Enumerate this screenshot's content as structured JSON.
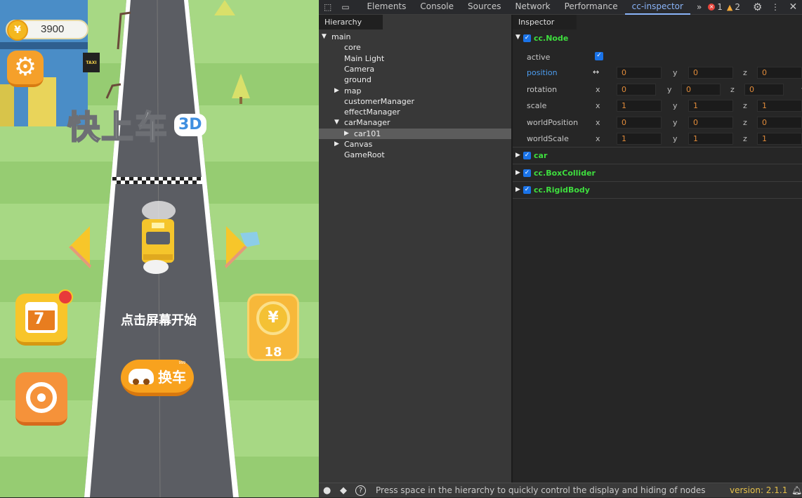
{
  "game": {
    "coins": "3900",
    "title": "快上车",
    "title_badge": "3D",
    "taxi_sign": "TAXI",
    "start_hint": "点击屏幕开始",
    "calendar_day": "7",
    "reward_count": "18",
    "change_car_label": "换车",
    "change_car_tag": "999"
  },
  "devtools": {
    "tabs": [
      "Elements",
      "Console",
      "Sources",
      "Network",
      "Performance",
      "cc-inspector"
    ],
    "active_tab": "cc-inspector",
    "error_count": "1",
    "warning_count": "2",
    "hierarchy": {
      "title": "Hierarchy",
      "nodes": [
        {
          "label": "main",
          "depth": 0,
          "expander": "open"
        },
        {
          "label": "core",
          "depth": 1,
          "expander": "none"
        },
        {
          "label": "Main Light",
          "depth": 1,
          "expander": "none"
        },
        {
          "label": "Camera",
          "depth": 1,
          "expander": "none"
        },
        {
          "label": "ground",
          "depth": 1,
          "expander": "none"
        },
        {
          "label": "map",
          "depth": 1,
          "expander": "closed"
        },
        {
          "label": "customerManager",
          "depth": 1,
          "expander": "none"
        },
        {
          "label": "effectManager",
          "depth": 1,
          "expander": "none"
        },
        {
          "label": "carManager",
          "depth": 1,
          "expander": "open"
        },
        {
          "label": "car101",
          "depth": 2,
          "expander": "closed",
          "selected": true
        },
        {
          "label": "Canvas",
          "depth": 1,
          "expander": "closed"
        },
        {
          "label": "GameRoot",
          "depth": 1,
          "expander": "none"
        }
      ]
    },
    "inspector": {
      "title": "Inspector",
      "node_component": "cc.Node",
      "active_label": "active",
      "active_checked": true,
      "properties": [
        {
          "label": "position",
          "highlight": true,
          "axes": [
            "",
            "y",
            "z"
          ],
          "values": [
            "0",
            "0",
            "0"
          ]
        },
        {
          "label": "rotation",
          "highlight": false,
          "axes": [
            "x",
            "y",
            "z",
            "w"
          ],
          "values": [
            "0",
            "0",
            "0"
          ]
        },
        {
          "label": "scale",
          "highlight": false,
          "axes": [
            "x",
            "y",
            "z"
          ],
          "values": [
            "1",
            "1",
            "1"
          ]
        },
        {
          "label": "worldPosition",
          "highlight": false,
          "axes": [
            "x",
            "y",
            "z"
          ],
          "values": [
            "0",
            "0",
            "0"
          ]
        },
        {
          "label": "worldScale",
          "highlight": false,
          "axes": [
            "x",
            "y",
            "z"
          ],
          "values": [
            "1",
            "1",
            "1"
          ]
        }
      ],
      "components": [
        "car",
        "cc.BoxCollider",
        "cc.RigidBody"
      ]
    },
    "footer_message": "Press space in the hierarchy to quickly control the display and hiding of nodes",
    "version": "version: 2.1.1"
  },
  "colors": {
    "component_green": "#3ede3e",
    "accent_blue": "#8ab4f8",
    "value_orange": "#e08b3a",
    "version_yellow": "#e5c04a"
  }
}
